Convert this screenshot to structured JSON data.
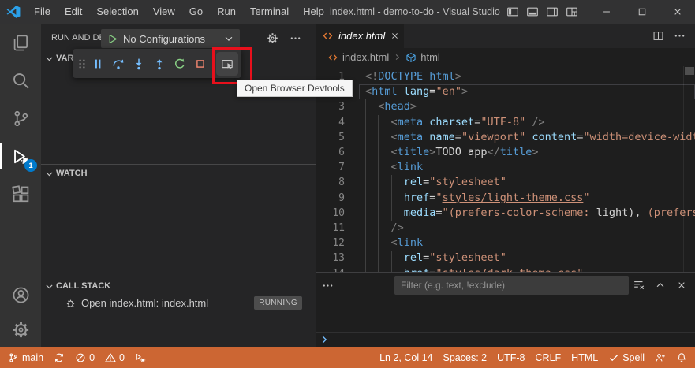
{
  "colors": {
    "titleBar": "#323233",
    "activityBar": "#333333",
    "sideBar": "#252526",
    "editor": "#1E1E1E",
    "statusBarDebugging": "#CC6633",
    "badge": "#007ACC",
    "annotation": "#E8101C",
    "fileIconOrange": "#E37933",
    "symbolBlue": "#4BA3E3",
    "debugBlue": "#75BEFF",
    "debugGreen": "#89D185",
    "debugRed": "#F48771",
    "syntax": {
      "tag": "#569CD6",
      "attribute": "#9CDCFE",
      "string": "#CE9178",
      "punctuation": "#808080",
      "text": "#D4D4D4"
    }
  },
  "titleBar": {
    "menus": [
      "File",
      "Edit",
      "Selection",
      "View",
      "Go",
      "Run",
      "Terminal",
      "Help"
    ],
    "title": "index.html - demo-to-do - Visual Studio C...",
    "layoutIcons": [
      "layout-sidebar-left",
      "layout-panel",
      "layout-sidebar-right",
      "layout-grid"
    ],
    "windowControls": [
      "minimize",
      "maximize",
      "close"
    ]
  },
  "activityBar": {
    "top": [
      {
        "id": "explorer",
        "icon": "files"
      },
      {
        "id": "search",
        "icon": "search"
      },
      {
        "id": "source-control",
        "icon": "source-control"
      },
      {
        "id": "run-and-debug",
        "icon": "debug-alt",
        "active": true,
        "badge": "1"
      },
      {
        "id": "extensions",
        "icon": "extensions"
      }
    ],
    "bottom": [
      {
        "id": "accounts",
        "icon": "account"
      },
      {
        "id": "settings",
        "icon": "gear"
      }
    ]
  },
  "sideBar": {
    "title": "RUN AND DEBUG",
    "configDropdown": {
      "label": "No Configurations"
    },
    "variablesLabel": "VARIABLES",
    "watchLabel": "WATCH",
    "callStackLabel": "CALL STACK",
    "callStackItem": {
      "label": "Open index.html: index.html",
      "status": "RUNNING"
    }
  },
  "debugToolbar": {
    "tooltip": "Open Browser Devtools",
    "buttons": [
      {
        "id": "drag-handle",
        "icon": "gripper"
      },
      {
        "id": "pause",
        "icon": "pause"
      },
      {
        "id": "step-over",
        "icon": "step-over"
      },
      {
        "id": "step-into",
        "icon": "step-into"
      },
      {
        "id": "step-out",
        "icon": "step-out"
      },
      {
        "id": "restart",
        "icon": "restart"
      },
      {
        "id": "stop",
        "icon": "stop"
      },
      {
        "id": "open-browser-devtools",
        "icon": "devtools",
        "highlighted": true
      }
    ]
  },
  "editor": {
    "tab": {
      "label": "index.html"
    },
    "breadcrumb": {
      "file": "index.html",
      "symbol": "html"
    },
    "cursor": {
      "line": 2,
      "column": 14
    },
    "lines": [
      {
        "n": 1,
        "ind": 0,
        "t": [
          [
            "p",
            "<!"
          ],
          [
            "t",
            "DOCTYPE"
          ],
          [
            "t",
            " html"
          ],
          [
            "p",
            ">"
          ]
        ]
      },
      {
        "n": 2,
        "ind": 0,
        "t": [
          [
            "p",
            "<"
          ],
          [
            "t",
            "html"
          ],
          [
            "a",
            " lang"
          ],
          [
            "x",
            "="
          ],
          [
            "s",
            "\"en\""
          ],
          [
            "p",
            ">"
          ]
        ]
      },
      {
        "n": 3,
        "ind": 2,
        "t": [
          [
            "p",
            "  <"
          ],
          [
            "t",
            "head"
          ],
          [
            "p",
            ">"
          ]
        ]
      },
      {
        "n": 4,
        "ind": 4,
        "t": [
          [
            "p",
            "    <"
          ],
          [
            "t",
            "meta"
          ],
          [
            "a",
            " charset"
          ],
          [
            "x",
            "="
          ],
          [
            "s",
            "\"UTF-8\""
          ],
          [
            "p",
            " />"
          ]
        ]
      },
      {
        "n": 5,
        "ind": 4,
        "t": [
          [
            "p",
            "    <"
          ],
          [
            "t",
            "meta"
          ],
          [
            "a",
            " name"
          ],
          [
            "x",
            "="
          ],
          [
            "s",
            "\"viewport\""
          ],
          [
            "a",
            " content"
          ],
          [
            "x",
            "="
          ],
          [
            "s",
            "\"width=device-width,"
          ]
        ]
      },
      {
        "n": 6,
        "ind": 4,
        "t": [
          [
            "p",
            "    <"
          ],
          [
            "t",
            "title"
          ],
          [
            "p",
            ">"
          ],
          [
            "x",
            "TODO app"
          ],
          [
            "p",
            "</"
          ],
          [
            "t",
            "title"
          ],
          [
            "p",
            ">"
          ]
        ]
      },
      {
        "n": 7,
        "ind": 4,
        "t": [
          [
            "p",
            "    <"
          ],
          [
            "t",
            "link"
          ]
        ]
      },
      {
        "n": 8,
        "ind": 6,
        "t": [
          [
            "a",
            "      rel"
          ],
          [
            "x",
            "="
          ],
          [
            "s",
            "\"stylesheet\""
          ]
        ]
      },
      {
        "n": 9,
        "ind": 6,
        "t": [
          [
            "a",
            "      href"
          ],
          [
            "x",
            "="
          ],
          [
            "s",
            "\""
          ],
          [
            "u",
            "styles/light-theme.css"
          ],
          [
            "s",
            "\""
          ]
        ]
      },
      {
        "n": 10,
        "ind": 6,
        "t": [
          [
            "a",
            "      media"
          ],
          [
            "x",
            "="
          ],
          [
            "s",
            "\"(prefers-color-scheme: "
          ],
          [
            "x",
            "light), "
          ],
          [
            "s",
            "(prefers-co"
          ]
        ]
      },
      {
        "n": 11,
        "ind": 4,
        "t": [
          [
            "p",
            "    />"
          ]
        ]
      },
      {
        "n": 12,
        "ind": 4,
        "t": [
          [
            "p",
            "    <"
          ],
          [
            "t",
            "link"
          ]
        ]
      },
      {
        "n": 13,
        "ind": 6,
        "t": [
          [
            "a",
            "      rel"
          ],
          [
            "x",
            "="
          ],
          [
            "s",
            "\"stylesheet\""
          ]
        ]
      },
      {
        "n": 14,
        "ind": 6,
        "t": [
          [
            "a",
            "      href"
          ],
          [
            "x",
            "="
          ],
          [
            "s",
            "\""
          ],
          [
            "u",
            "styles/dark-theme.css"
          ],
          [
            "s",
            "\""
          ]
        ]
      }
    ]
  },
  "panel": {
    "filterPlaceholder": "Filter (e.g. text, !exclude)"
  },
  "statusBar": {
    "left": [
      {
        "id": "branch",
        "icon": "git-branch",
        "label": "main"
      },
      {
        "id": "sync",
        "icon": "sync",
        "label": ""
      },
      {
        "id": "errors",
        "icon": "error",
        "label": "0"
      },
      {
        "id": "warnings",
        "icon": "warning",
        "label": "0"
      },
      {
        "id": "debug-console",
        "icon": "debug-status",
        "label": ""
      }
    ],
    "right": [
      {
        "id": "cursor-position",
        "label": "Ln 2, Col 14"
      },
      {
        "id": "indentation",
        "label": "Spaces: 2"
      },
      {
        "id": "encoding",
        "label": "UTF-8"
      },
      {
        "id": "eol",
        "label": "CRLF"
      },
      {
        "id": "language-mode",
        "label": "HTML"
      },
      {
        "id": "spell",
        "icon": "check",
        "label": "Spell"
      },
      {
        "id": "feedback",
        "icon": "feedback",
        "label": ""
      },
      {
        "id": "notifications",
        "icon": "bell",
        "label": ""
      }
    ]
  }
}
